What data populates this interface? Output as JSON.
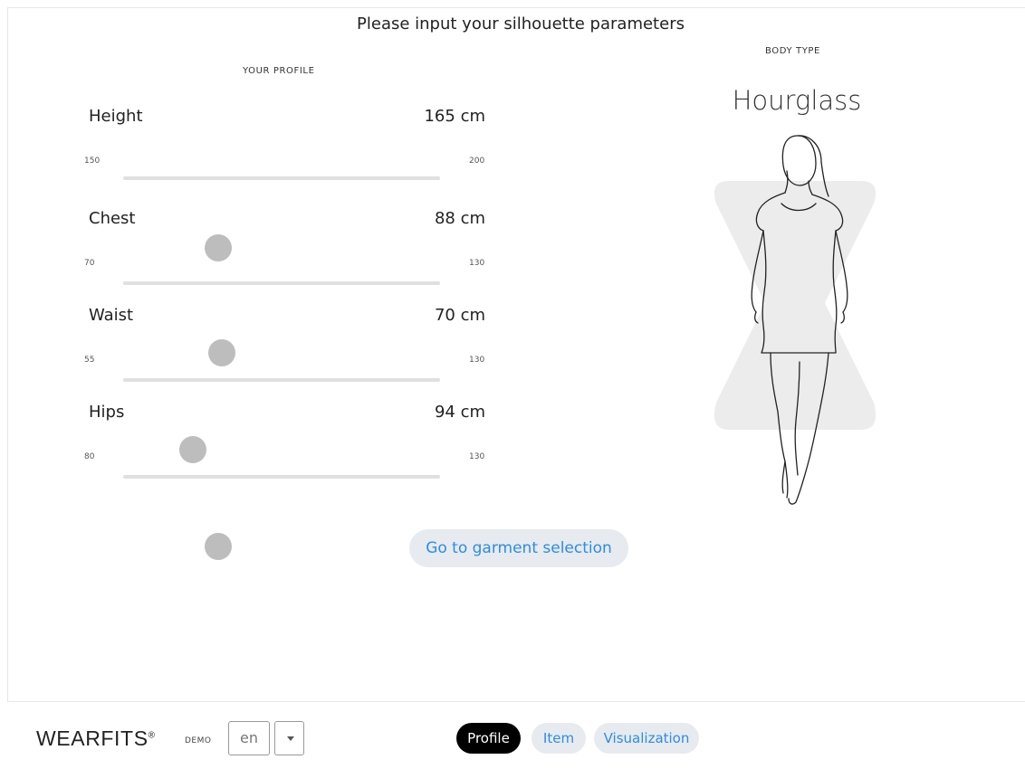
{
  "page": {
    "title": "Please input your silhouette parameters"
  },
  "profile": {
    "label": "YOUR PROFILE",
    "params": [
      {
        "name": "Height",
        "value": "165 cm",
        "min": "150",
        "max": "200",
        "level": 0.3
      },
      {
        "name": "Chest",
        "value": "88 cm",
        "min": "70",
        "max": "130",
        "level": 0.31
      },
      {
        "name": "Waist",
        "value": "70 cm",
        "min": "55",
        "max": "130",
        "level": 0.22
      },
      {
        "name": "Hips",
        "value": "94 cm",
        "min": "80",
        "max": "130",
        "level": 0.3
      }
    ]
  },
  "body_type": {
    "label": "BODY TYPE",
    "value": "Hourglass",
    "shape_color": "#ececec",
    "icon": "hourglass-silhouette-icon"
  },
  "cta": {
    "label": "Go to garment selection"
  },
  "footer": {
    "logo": "WEARFITS",
    "logo_mark": "®",
    "demo": "DEMO",
    "language": "en",
    "tabs": [
      {
        "label": "Profile",
        "active": true
      },
      {
        "label": "Item",
        "active": false
      },
      {
        "label": "Visualization",
        "active": false
      }
    ]
  },
  "colors": {
    "accent": "#2b8ee6",
    "active_tab": "#000000",
    "pill_bg": "#e7eaee",
    "slider_thumb": "#bdbdbd",
    "slider_track": "#e0e0e0"
  }
}
